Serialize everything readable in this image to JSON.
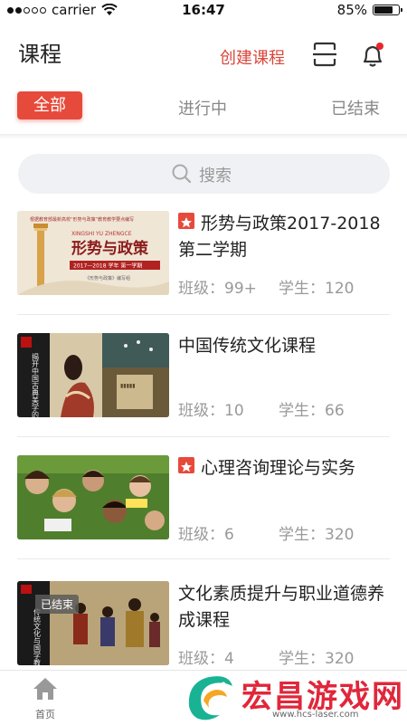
{
  "status": {
    "carrier": "carrier",
    "time": "16:47",
    "battery": "85%",
    "battery_level": 0.85
  },
  "header": {
    "title": "课程",
    "create_label": "创建课程"
  },
  "tabs": [
    {
      "label": "全部",
      "active": true
    },
    {
      "label": "进行中",
      "active": false
    },
    {
      "label": "已结束",
      "active": false
    }
  ],
  "search": {
    "placeholder": "搜索"
  },
  "courses": [
    {
      "name": "形势与政策2017-2018第二学期",
      "starred": true,
      "classes_label": "班级：",
      "classes": "99+",
      "students_label": "学生：",
      "students": "120",
      "cover": {
        "top": "根据教育部最新高校“形势与政策”教育教学要点编写",
        "pinyin": "XINGSHI YU ZHENGCE",
        "title": "形势与政策",
        "band": "2017—2018 学年 第一学期",
        "sub": "《形势与政策》编写组"
      }
    },
    {
      "name": "中国传统文化课程",
      "starred": false,
      "classes_label": "班级：",
      "classes": "10",
      "students_label": "学生：",
      "students": "66",
      "cover": {
        "text": "揭开中国古典美学的帷幕"
      }
    },
    {
      "name": "心理咨询理论与实务",
      "starred": true,
      "classes_label": "班级：",
      "classes": "6",
      "students_label": "学生：",
      "students": "320"
    },
    {
      "name": "文化素质提升与职业道德养成课程",
      "starred": false,
      "ended_badge": "已结束",
      "classes_label": "班级：",
      "classes": "4",
      "students_label": "学生：",
      "students": "320",
      "cover": {
        "text": "传统文化与国学教育"
      }
    }
  ],
  "bottom_nav": {
    "home_label": "首页"
  },
  "watermark": {
    "title": "宏昌游戏网",
    "url": "www.hcs-laser.com"
  },
  "colors": {
    "accent": "#e64a3b",
    "text": "#222222",
    "muted": "#999999"
  }
}
